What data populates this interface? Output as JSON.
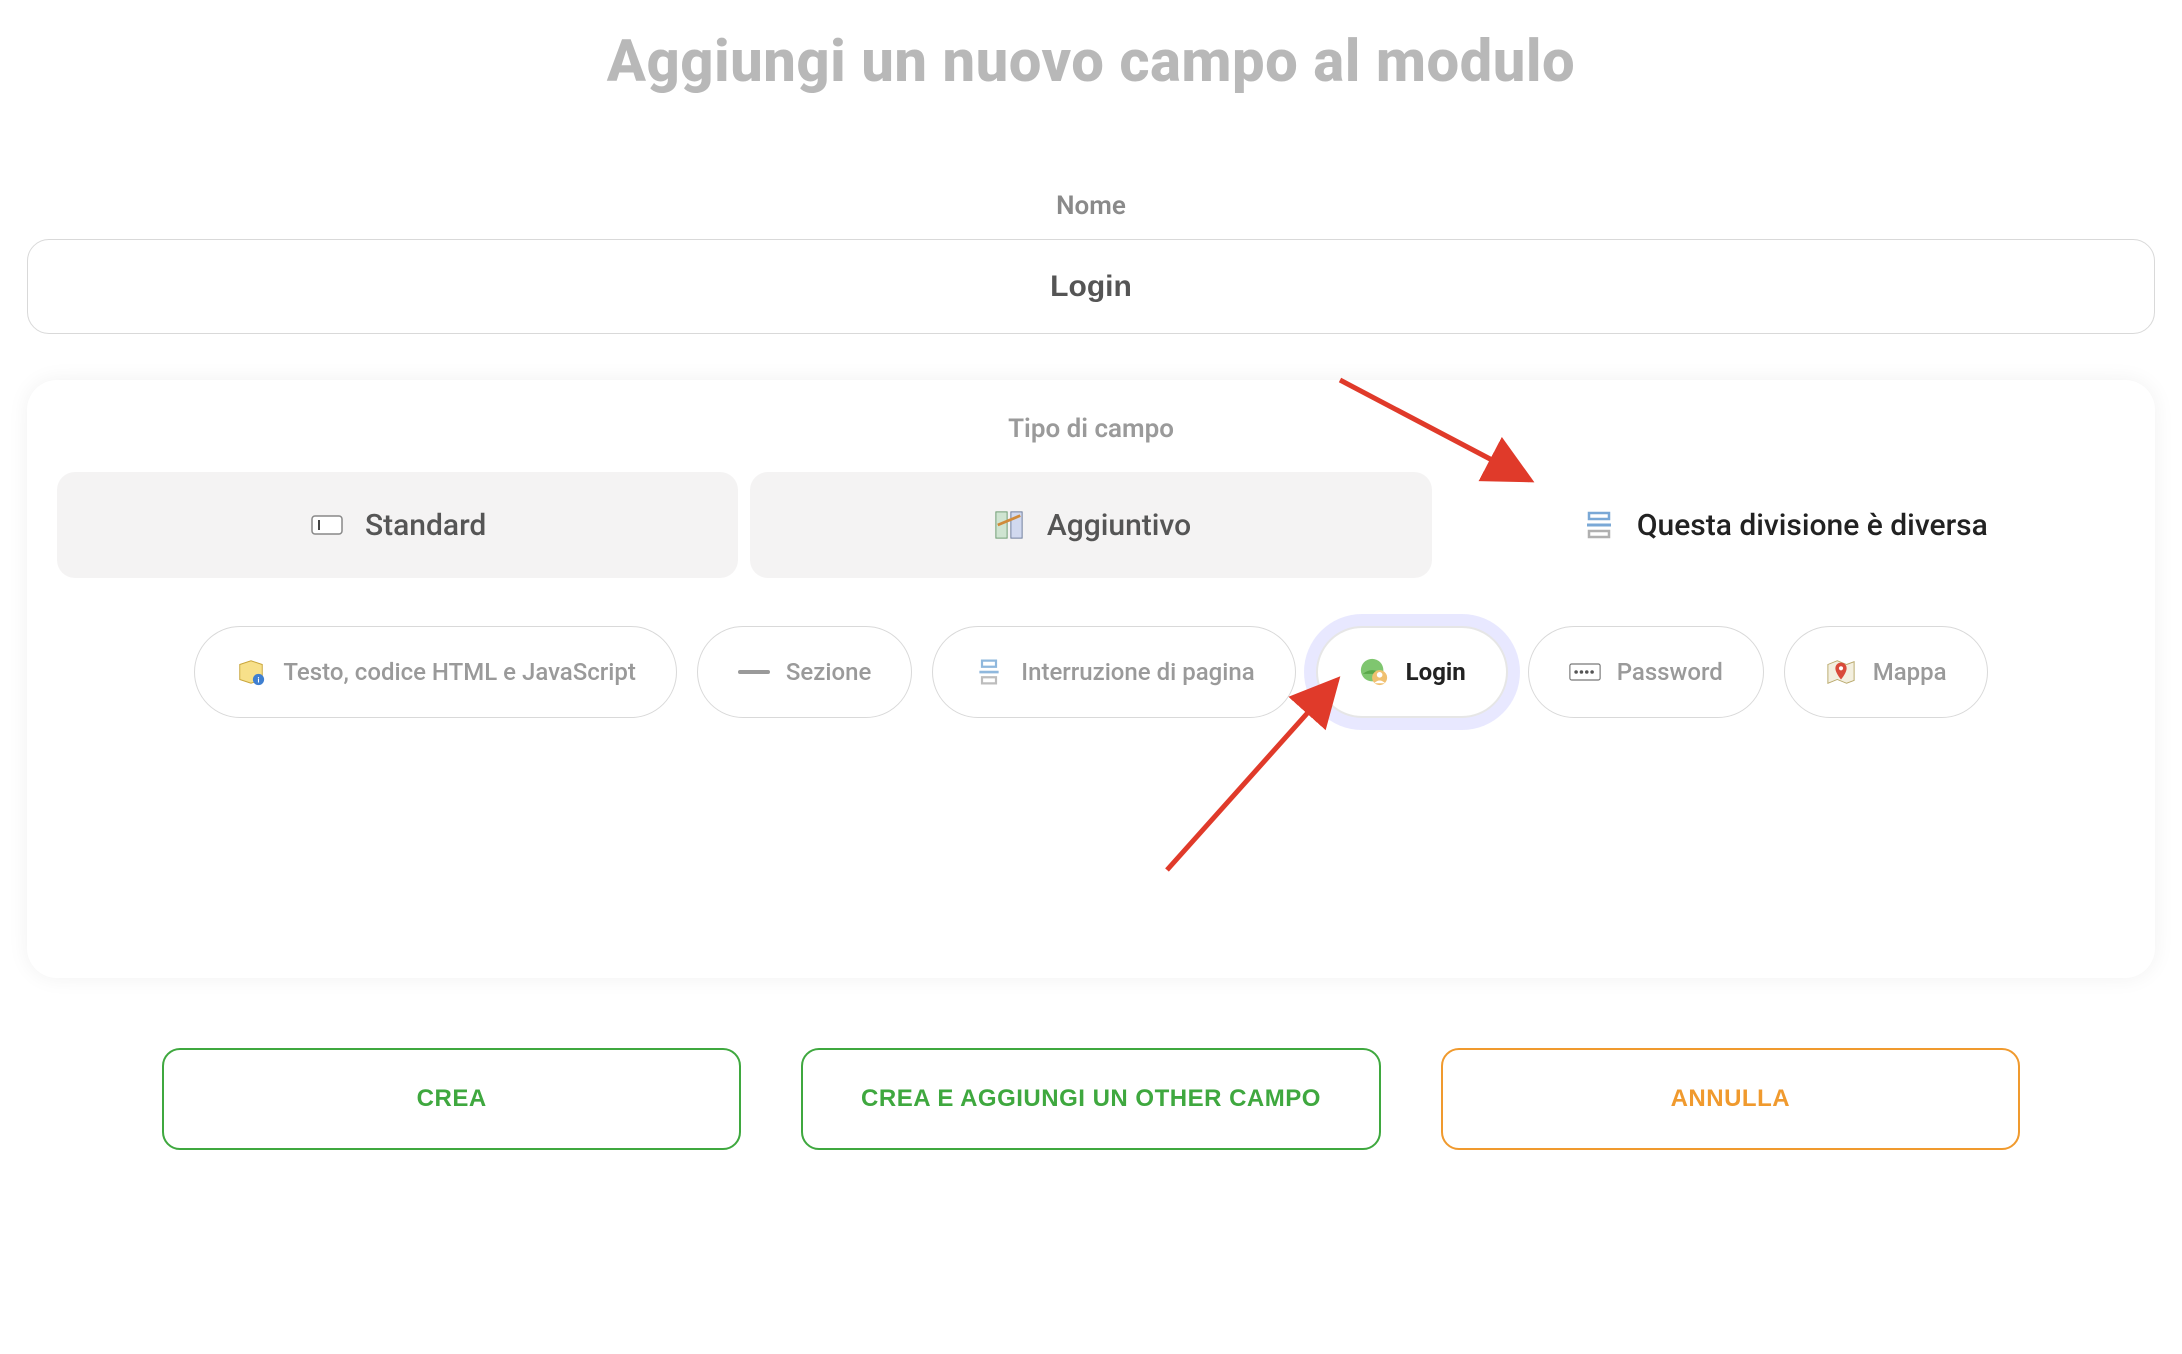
{
  "page_title": "Aggiungi un nuovo campo al modulo",
  "name_label": "Nome",
  "name_value": "Login",
  "type_label": "Tipo di campo",
  "tabs": [
    {
      "label": "Standard",
      "icon": "input-icon",
      "active": false
    },
    {
      "label": "Aggiuntivo",
      "icon": "advanced-icon",
      "active": false
    },
    {
      "label": "Questa divisione è diversa",
      "icon": "pagebreak-icon",
      "active": true
    }
  ],
  "subtypes": [
    {
      "label": "Testo, codice HTML e JavaScript",
      "icon": "doc-icon",
      "selected": false
    },
    {
      "label": "Sezione",
      "icon": "section-icon",
      "selected": false
    },
    {
      "label": "Interruzione di pagina",
      "icon": "pagebreak-icon",
      "selected": false
    },
    {
      "label": "Login",
      "icon": "user-globe-icon",
      "selected": true
    },
    {
      "label": "Password",
      "icon": "password-icon",
      "selected": false
    },
    {
      "label": "Mappa",
      "icon": "map-pin-icon",
      "selected": false
    }
  ],
  "buttons": {
    "create": "CREA",
    "create_add": "CREA E AGGIUNGI UN OTHER CAMPO",
    "cancel": "ANNULLA"
  }
}
